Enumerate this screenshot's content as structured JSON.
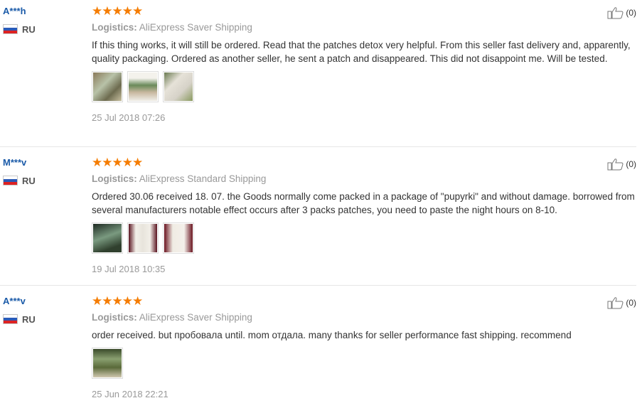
{
  "reviews": [
    {
      "user": "A***h",
      "country": "RU",
      "rating": 5,
      "logistics_label": "Logistics:",
      "logistics_value": "AliExpress Saver Shipping",
      "text": "If this thing works, it will still be ordered. Read that the patches detox very helpful. From this seller fast delivery and, apparently, quality packaging. Ordered as another seller, he sent a patch and disappeared. This did not disappoint me. Will be tested.",
      "date": "25 Jul 2018 07:26",
      "helpful": "(0)",
      "photos": 3
    },
    {
      "user": "M***v",
      "country": "RU",
      "rating": 5,
      "logistics_label": "Logistics:",
      "logistics_value": "AliExpress Standard Shipping",
      "text": "Ordered 30.06 received 18. 07. the Goods normally come packed in a package of \"pupyrki\" and without damage. borrowed from several manufacturers notable effect occurs after 3 packs patches, you need to paste the night hours on 8-10.",
      "date": "19 Jul 2018 10:35",
      "helpful": "(0)",
      "photos": 3
    },
    {
      "user": "A***v",
      "country": "RU",
      "rating": 5,
      "logistics_label": "Logistics:",
      "logistics_value": "AliExpress Saver Shipping",
      "text": "order received. but пробовала until. mom отдала. many thanks for seller performance fast shipping. recommend",
      "date": "25 Jun 2018 22:21",
      "helpful": "(0)",
      "photos": 1
    }
  ],
  "icons": {
    "star": "star-icon",
    "thumb": "thumbs-up-icon",
    "flag": "russia-flag-icon"
  },
  "colors": {
    "star": "#f57c00",
    "username": "#1a5aa8",
    "meta": "#999999"
  }
}
